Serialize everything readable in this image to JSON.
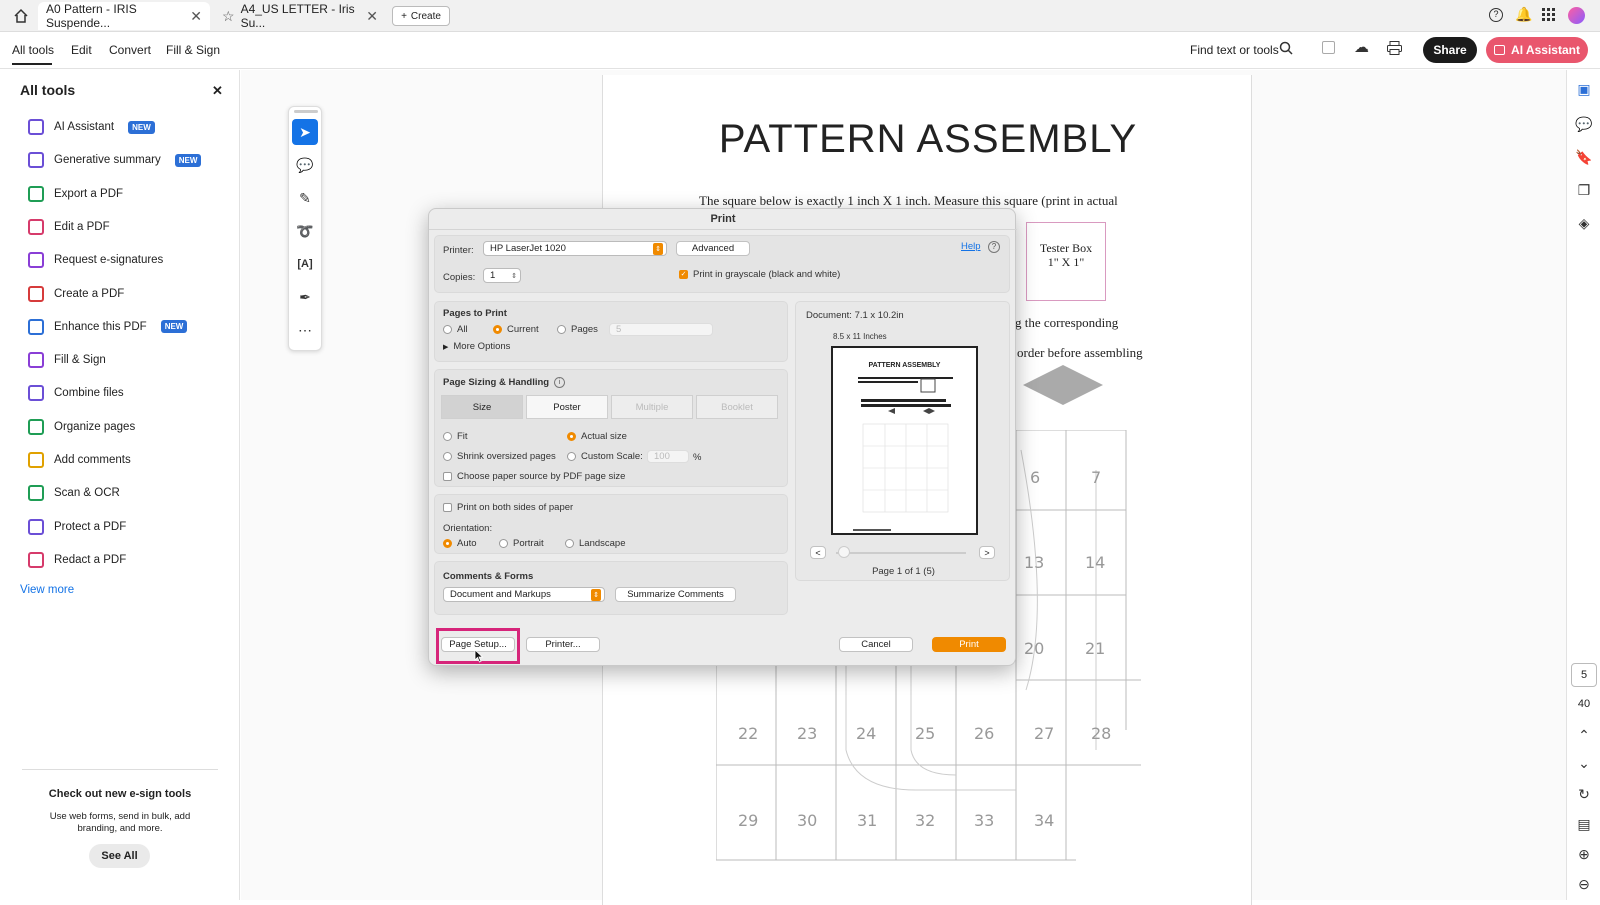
{
  "tabs": [
    {
      "label": "A0 Pattern - IRIS Suspende..."
    },
    {
      "label": "A4_US LETTER - Iris Su..."
    }
  ],
  "create_label": "Create",
  "menu": {
    "items": [
      "All tools",
      "Edit",
      "Convert",
      "Fill & Sign"
    ],
    "find_label": "Find text or tools",
    "share": "Share",
    "ai_assistant": "AI Assistant"
  },
  "sidebar": {
    "title": "All tools",
    "items": [
      {
        "label": "AI Assistant",
        "badge": "NEW",
        "color": "#6b4fd6"
      },
      {
        "label": "Generative summary",
        "badge": "NEW",
        "color": "#6b4fd6"
      },
      {
        "label": "Export a PDF",
        "badge": "",
        "color": "#1f9d55"
      },
      {
        "label": "Edit a PDF",
        "badge": "",
        "color": "#d63b6b"
      },
      {
        "label": "Request e-signatures",
        "badge": "",
        "color": "#8a3ed6"
      },
      {
        "label": "Create a PDF",
        "badge": "",
        "color": "#d63b3b"
      },
      {
        "label": "Enhance this PDF",
        "badge": "NEW",
        "color": "#2c6fd6"
      },
      {
        "label": "Fill & Sign",
        "badge": "",
        "color": "#8a3ed6"
      },
      {
        "label": "Combine files",
        "badge": "",
        "color": "#6b4fd6"
      },
      {
        "label": "Organize pages",
        "badge": "",
        "color": "#1f9d55"
      },
      {
        "label": "Add comments",
        "badge": "",
        "color": "#e0a100"
      },
      {
        "label": "Scan & OCR",
        "badge": "",
        "color": "#1f9d55"
      },
      {
        "label": "Protect a PDF",
        "badge": "",
        "color": "#6b4fd6"
      },
      {
        "label": "Redact a PDF",
        "badge": "",
        "color": "#d63b6b"
      }
    ],
    "view_more": "View more",
    "promo_title": "Check out new e-sign tools",
    "promo_text": "Use web forms, send in bulk, add branding, and more.",
    "see_all": "See All"
  },
  "document": {
    "heading": "PATTERN ASSEMBLY",
    "line1": "The square below is exactly 1 inch X 1 inch. Measure this square (print in actual",
    "tester_line1": "Tester Box",
    "tester_line2": "1\" X 1\"",
    "line2": "g the corresponding",
    "line3": "order before assembling",
    "grid_numbers_right": [
      "6",
      "7",
      "13",
      "14",
      "20",
      "21",
      "27",
      "28"
    ],
    "grid_row_22": [
      "22",
      "23",
      "24",
      "25",
      "26",
      "27",
      "28"
    ],
    "grid_row_29": [
      "29",
      "30",
      "31",
      "32",
      "33",
      "34"
    ]
  },
  "print_dialog": {
    "title": "Print",
    "printer_label": "Printer:",
    "printer_value": "HP LaserJet 1020",
    "advanced": "Advanced",
    "help": "Help",
    "copies_label": "Copies:",
    "copies_value": "1",
    "grayscale_label": "Print in grayscale (black and white)",
    "pages_to_print": "Pages to Print",
    "opt_all": "All",
    "opt_current": "Current",
    "opt_pages": "Pages",
    "pages_value": "5",
    "more_options": "More Options",
    "sizing_title": "Page Sizing & Handling",
    "seg_size": "Size",
    "seg_poster": "Poster",
    "seg_multiple": "Multiple",
    "seg_booklet": "Booklet",
    "fit": "Fit",
    "actual_size": "Actual size",
    "shrink": "Shrink oversized pages",
    "custom_scale": "Custom Scale:",
    "custom_scale_value": "100",
    "percent": "%",
    "paper_source": "Choose paper source by PDF page size",
    "both_sides": "Print on both sides of paper",
    "orientation": "Orientation:",
    "orient_auto": "Auto",
    "orient_portrait": "Portrait",
    "orient_landscape": "Landscape",
    "comments_title": "Comments & Forms",
    "comments_value": "Document and Markups",
    "summarize": "Summarize Comments",
    "page_setup": "Page Setup...",
    "printer_btn": "Printer...",
    "cancel": "Cancel",
    "print": "Print",
    "doc_size": "Document: 7.1 x 10.2in",
    "paper_size": "8.5 x 11 Inches",
    "preview_heading": "PATTERN ASSEMBLY",
    "page_of": "Page 1 of 1 (5)"
  },
  "rightrail": {
    "page_num": "5",
    "total": "40"
  },
  "colors": {
    "accent_orange": "#f08a00",
    "highlight_pink": "#d6257a",
    "brand_blue": "#1473e6",
    "ai_pink": "#e9566d"
  }
}
